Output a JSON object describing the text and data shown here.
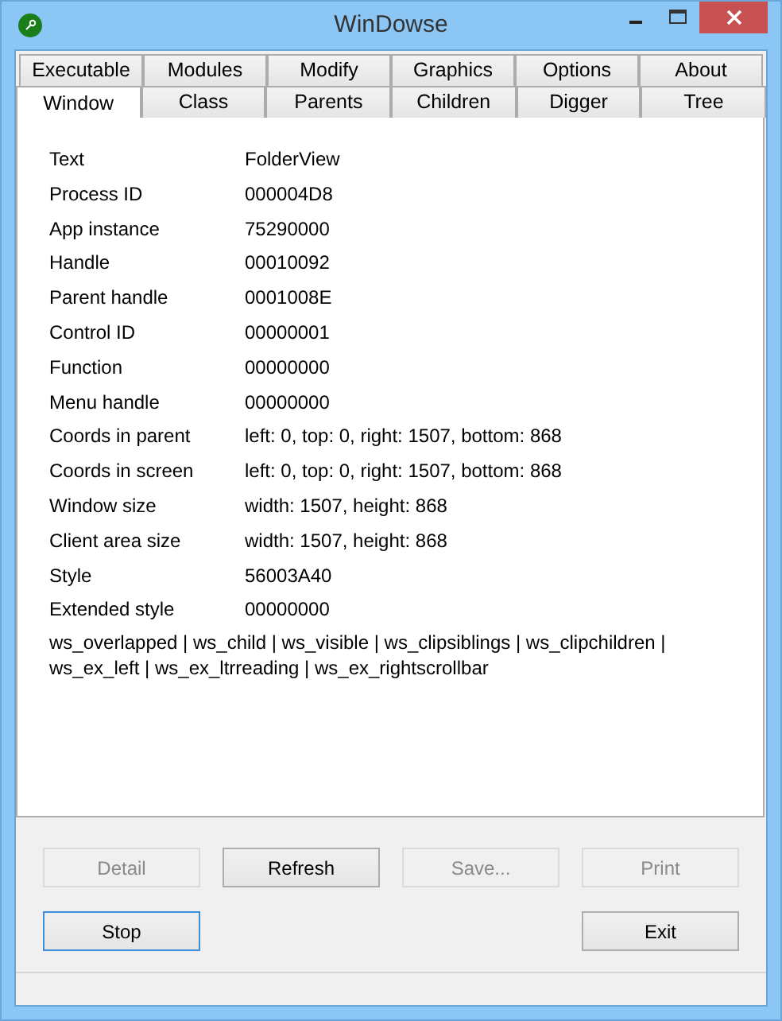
{
  "window": {
    "title": "WinDowse"
  },
  "tab_rows": [
    [
      {
        "label": "Executable",
        "selected": false
      },
      {
        "label": "Modules",
        "selected": false
      },
      {
        "label": "Modify",
        "selected": false
      },
      {
        "label": "Graphics",
        "selected": false
      },
      {
        "label": "Options",
        "selected": false
      },
      {
        "label": "About",
        "selected": false
      }
    ],
    [
      {
        "label": "Window",
        "selected": true
      },
      {
        "label": "Class",
        "selected": false
      },
      {
        "label": "Parents",
        "selected": false
      },
      {
        "label": "Children",
        "selected": false
      },
      {
        "label": "Digger",
        "selected": false
      },
      {
        "label": "Tree",
        "selected": false
      }
    ]
  ],
  "properties": [
    {
      "label": "Text",
      "value": "FolderView"
    },
    {
      "label": "Process ID",
      "value": "000004D8"
    },
    {
      "label": "App instance",
      "value": "75290000"
    },
    {
      "label": "Handle",
      "value": "00010092"
    },
    {
      "label": "Parent handle",
      "value": "0001008E"
    },
    {
      "label": "Control ID",
      "value": "00000001"
    },
    {
      "label": "Function",
      "value": "00000000"
    },
    {
      "label": "Menu handle",
      "value": "00000000"
    },
    {
      "label": "Coords in parent",
      "value": "left: 0, top: 0, right: 1507, bottom: 868"
    },
    {
      "label": "Coords in screen",
      "value": "left: 0, top: 0, right: 1507, bottom: 868"
    },
    {
      "label": "Window size",
      "value": "width: 1507, height: 868"
    },
    {
      "label": "Client area size",
      "value": "width: 1507, height: 868"
    },
    {
      "label": "Style",
      "value": "56003A40"
    },
    {
      "label": "Extended style",
      "value": "00000000"
    }
  ],
  "style_flags": "ws_overlapped | ws_child | ws_visible | ws_clipsiblings | ws_clipchildren | ws_ex_left | ws_ex_ltrreading | ws_ex_rightscrollbar",
  "button_rows": [
    [
      {
        "label": "Detail",
        "disabled": true,
        "focused": false
      },
      {
        "label": "Refresh",
        "disabled": false,
        "focused": false
      },
      {
        "label": "Save...",
        "disabled": true,
        "focused": false
      },
      {
        "label": "Print",
        "disabled": true,
        "focused": false
      }
    ],
    [
      {
        "label": "Stop",
        "disabled": false,
        "focused": true
      },
      {
        "label": "Exit",
        "disabled": false,
        "focused": false
      }
    ]
  ]
}
